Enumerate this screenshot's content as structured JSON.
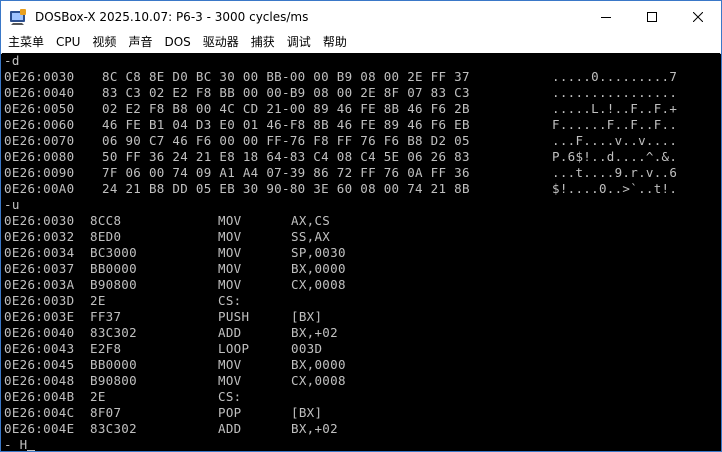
{
  "window": {
    "title": "DOSBox-X 2025.10.07: P6-3 - 3000 cycles/ms",
    "icon": "dosbox-app-icon",
    "controls": [
      "minimize",
      "maximize",
      "close"
    ]
  },
  "menu": [
    "主菜单",
    "CPU",
    "视频",
    "声音",
    "DOS",
    "驱动器",
    "捕获",
    "调试",
    "帮助"
  ],
  "console": {
    "d_command": "-d",
    "dump_rows": [
      {
        "addr": "0E26:0030",
        "hex": "8C C8 8E D0 BC 30 00 BB-00 00 B9 08 00 2E FF 37",
        "ascii": ".....0.........7"
      },
      {
        "addr": "0E26:0040",
        "hex": "83 C3 02 E2 F8 BB 00 00-B9 08 00 2E 8F 07 83 C3",
        "ascii": "................"
      },
      {
        "addr": "0E26:0050",
        "hex": "02 E2 F8 B8 00 4C CD 21-00 89 46 FE 8B 46 F6 2B",
        "ascii": ".....L.!..F..F.+"
      },
      {
        "addr": "0E26:0060",
        "hex": "46 FE B1 04 D3 E0 01 46-F8 8B 46 FE 89 46 F6 EB",
        "ascii": "F......F..F..F.."
      },
      {
        "addr": "0E26:0070",
        "hex": "06 90 C7 46 F6 00 00 FF-76 F8 FF 76 F6 B8 D2 05",
        "ascii": "...F....v..v...."
      },
      {
        "addr": "0E26:0080",
        "hex": "50 FF 36 24 21 E8 18 64-83 C4 08 C4 5E 06 26 83",
        "ascii": "P.6$!..d....^.&."
      },
      {
        "addr": "0E26:0090",
        "hex": "7F 06 00 74 09 A1 A4 07-39 86 72 FF 76 0A FF 36",
        "ascii": "...t....9.r.v..6"
      },
      {
        "addr": "0E26:00A0",
        "hex": "24 21 B8 DD 05 EB 30 90-80 3E 60 08 00 74 21 8B",
        "ascii": "$!....0..>`..t!."
      }
    ],
    "u_command": "-u",
    "disasm_rows": [
      {
        "addr": "0E26:0030",
        "bytes": "8CC8",
        "mnemonic": "MOV",
        "operands": "AX,CS"
      },
      {
        "addr": "0E26:0032",
        "bytes": "8ED0",
        "mnemonic": "MOV",
        "operands": "SS,AX"
      },
      {
        "addr": "0E26:0034",
        "bytes": "BC3000",
        "mnemonic": "MOV",
        "operands": "SP,0030"
      },
      {
        "addr": "0E26:0037",
        "bytes": "BB0000",
        "mnemonic": "MOV",
        "operands": "BX,0000"
      },
      {
        "addr": "0E26:003A",
        "bytes": "B90800",
        "mnemonic": "MOV",
        "operands": "CX,0008"
      },
      {
        "addr": "0E26:003D",
        "bytes": "2E",
        "mnemonic": "CS:",
        "operands": ""
      },
      {
        "addr": "0E26:003E",
        "bytes": "FF37",
        "mnemonic": "PUSH",
        "operands": "[BX]"
      },
      {
        "addr": "0E26:0040",
        "bytes": "83C302",
        "mnemonic": "ADD",
        "operands": "BX,+02"
      },
      {
        "addr": "0E26:0043",
        "bytes": "E2F8",
        "mnemonic": "LOOP",
        "operands": "003D"
      },
      {
        "addr": "0E26:0045",
        "bytes": "BB0000",
        "mnemonic": "MOV",
        "operands": "BX,0000"
      },
      {
        "addr": "0E26:0048",
        "bytes": "B90800",
        "mnemonic": "MOV",
        "operands": "CX,0008"
      },
      {
        "addr": "0E26:004B",
        "bytes": "2E",
        "mnemonic": "CS:",
        "operands": ""
      },
      {
        "addr": "0E26:004C",
        "bytes": "8F07",
        "mnemonic": "POP",
        "operands": "[BX]"
      },
      {
        "addr": "0E26:004E",
        "bytes": "83C302",
        "mnemonic": "ADD",
        "operands": "BX,+02"
      }
    ],
    "prompt_line": "- H",
    "colors": {
      "text": "#c0c0c0",
      "background": "#000000"
    }
  }
}
